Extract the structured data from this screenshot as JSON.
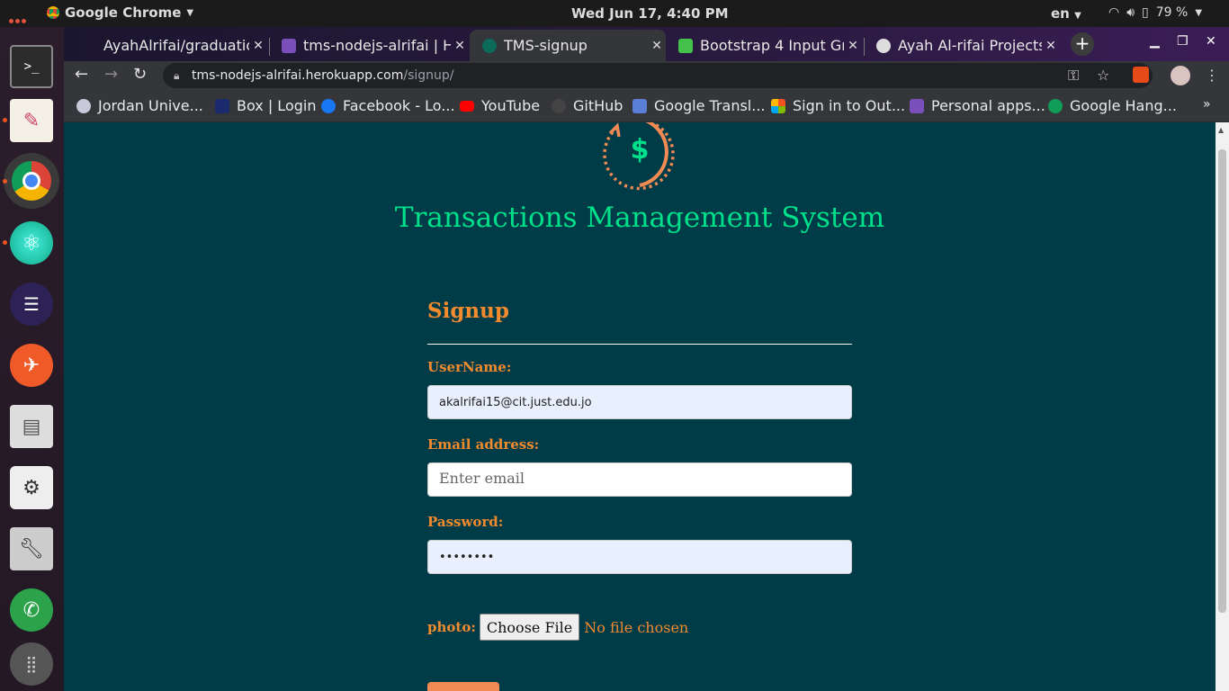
{
  "system": {
    "app_name": "Google Chrome",
    "clock": "Wed Jun 17,  4:40 PM",
    "language": "en",
    "battery": "79 %"
  },
  "tabs": [
    {
      "title": "AyahAlrifai/graduation",
      "active": false
    },
    {
      "title": "tms-nodejs-alrifai | He",
      "active": false
    },
    {
      "title": "TMS-signup",
      "active": true
    },
    {
      "title": "Bootstrap 4 Input Gro",
      "active": false
    },
    {
      "title": "Ayah Al-rifai Projects",
      "active": false
    }
  ],
  "address": {
    "host": "tms-nodejs-alrifai.herokuapp.com",
    "path": "/signup/"
  },
  "bookmarks": [
    "Jordan Unive...",
    "Box | Login",
    "Facebook - Lo...",
    "YouTube",
    "GitHub",
    "Google Transl...",
    "Sign in to Out...",
    "Personal apps...",
    "Google Hang..."
  ],
  "page": {
    "site_title": "Transactions Management System",
    "heading": "Signup",
    "username_label": "UserName:",
    "username_value": "akalrifai15@cit.just.edu.jo",
    "email_label": "Email address:",
    "email_placeholder": "Enter email",
    "password_label": "Password:",
    "password_value": "••••••••",
    "photo_label": "photo:",
    "choose_file_label": "Choose File",
    "no_file_text": "No file chosen"
  },
  "colors": {
    "page_bg": "#003c48",
    "title_green": "#00e08a",
    "accent_orange": "#f28a2e"
  }
}
